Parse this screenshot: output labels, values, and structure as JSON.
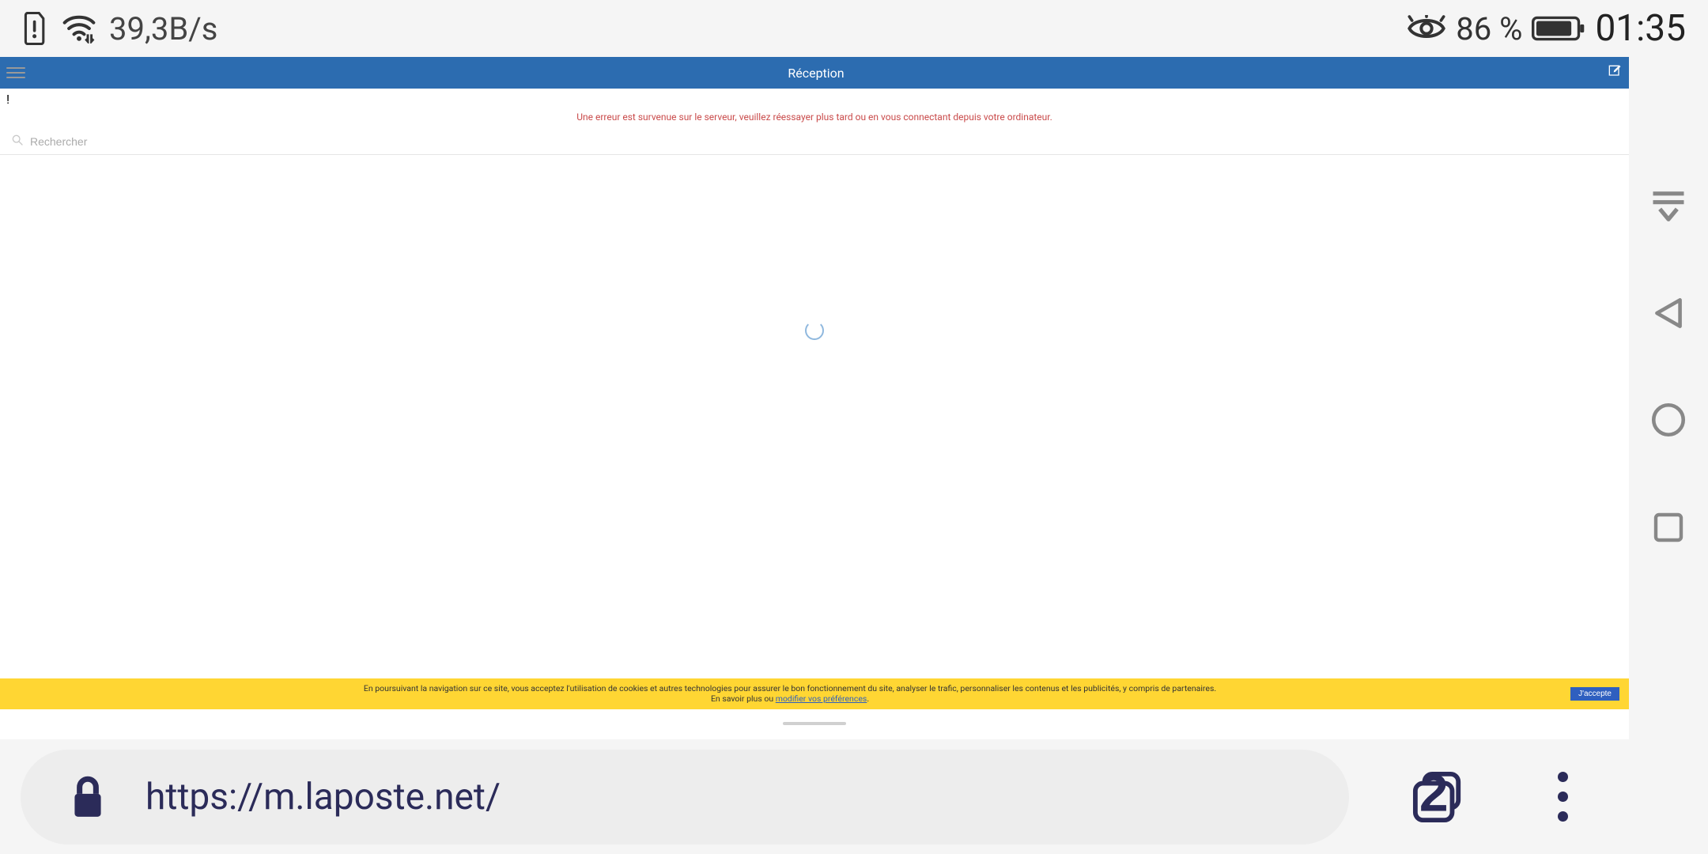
{
  "statusbar": {
    "netspeed": "39,3B/s",
    "battery_pct": "86 %",
    "clock": "01:35"
  },
  "app": {
    "title": "Réception"
  },
  "error": {
    "message": "Une erreur est survenue sur le serveur, veuillez réessayer plus tard ou en vous connectant depuis votre ordinateur."
  },
  "search": {
    "placeholder": "Rechercher"
  },
  "cookie": {
    "line1": "En poursuivant la navigation sur ce site, vous acceptez l'utilisation de cookies et autres technologies pour assurer le bon fonctionnement du site, analyser le trafic, personnaliser les contenus et les publicités, y compris de partenaires.",
    "line2_prefix": "En savoir plus ou ",
    "line2_link": "modifier vos préférences",
    "accept": "J'accepte"
  },
  "browser": {
    "url": "https://m.laposte.net/",
    "tab_count": "2"
  }
}
